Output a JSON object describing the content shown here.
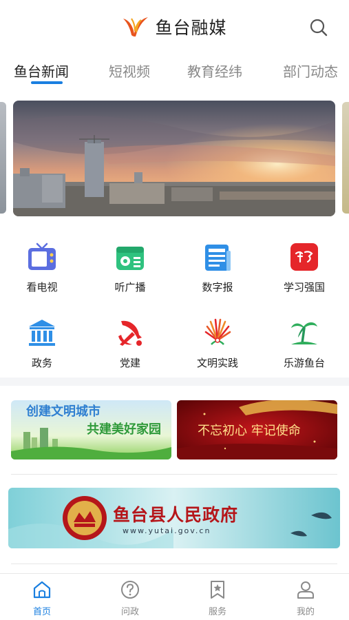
{
  "header": {
    "title": "鱼台融媒",
    "logo_icon": "swallow-logo-icon",
    "search_icon": "search-icon"
  },
  "tabs": [
    {
      "label": "鱼台新闻",
      "active": true
    },
    {
      "label": "短视频",
      "active": false
    },
    {
      "label": "教育经纬",
      "active": false
    },
    {
      "label": "部门动态",
      "active": false
    }
  ],
  "banner": {
    "description": "city-sunset-photo"
  },
  "grid": [
    {
      "label": "看电视",
      "icon": "tv-icon"
    },
    {
      "label": "听广播",
      "icon": "radio-icon"
    },
    {
      "label": "数字报",
      "icon": "newspaper-icon"
    },
    {
      "label": "学习强国",
      "icon": "xuexi-icon"
    },
    {
      "label": "政务",
      "icon": "government-building-icon"
    },
    {
      "label": "党建",
      "icon": "party-emblem-icon"
    },
    {
      "label": "文明实践",
      "icon": "civilization-emblem-icon"
    },
    {
      "label": "乐游鱼台",
      "icon": "palm-tree-icon"
    }
  ],
  "promos": {
    "left": {
      "line1": "创建文明城市",
      "line2": "共建美好家园"
    },
    "right": {
      "text": "不忘初心 牢记使命"
    }
  },
  "gov": {
    "title": "鱼台县人民政府",
    "url": "www.yutai.gov.cn"
  },
  "bottom_nav": [
    {
      "label": "首页",
      "icon": "home-icon",
      "active": true
    },
    {
      "label": "问政",
      "icon": "question-icon",
      "active": false
    },
    {
      "label": "服务",
      "icon": "bookmark-star-icon",
      "active": false
    },
    {
      "label": "我的",
      "icon": "user-icon",
      "active": false
    }
  ],
  "colors": {
    "accent": "#1a7fe0",
    "red": "#d42a22"
  }
}
